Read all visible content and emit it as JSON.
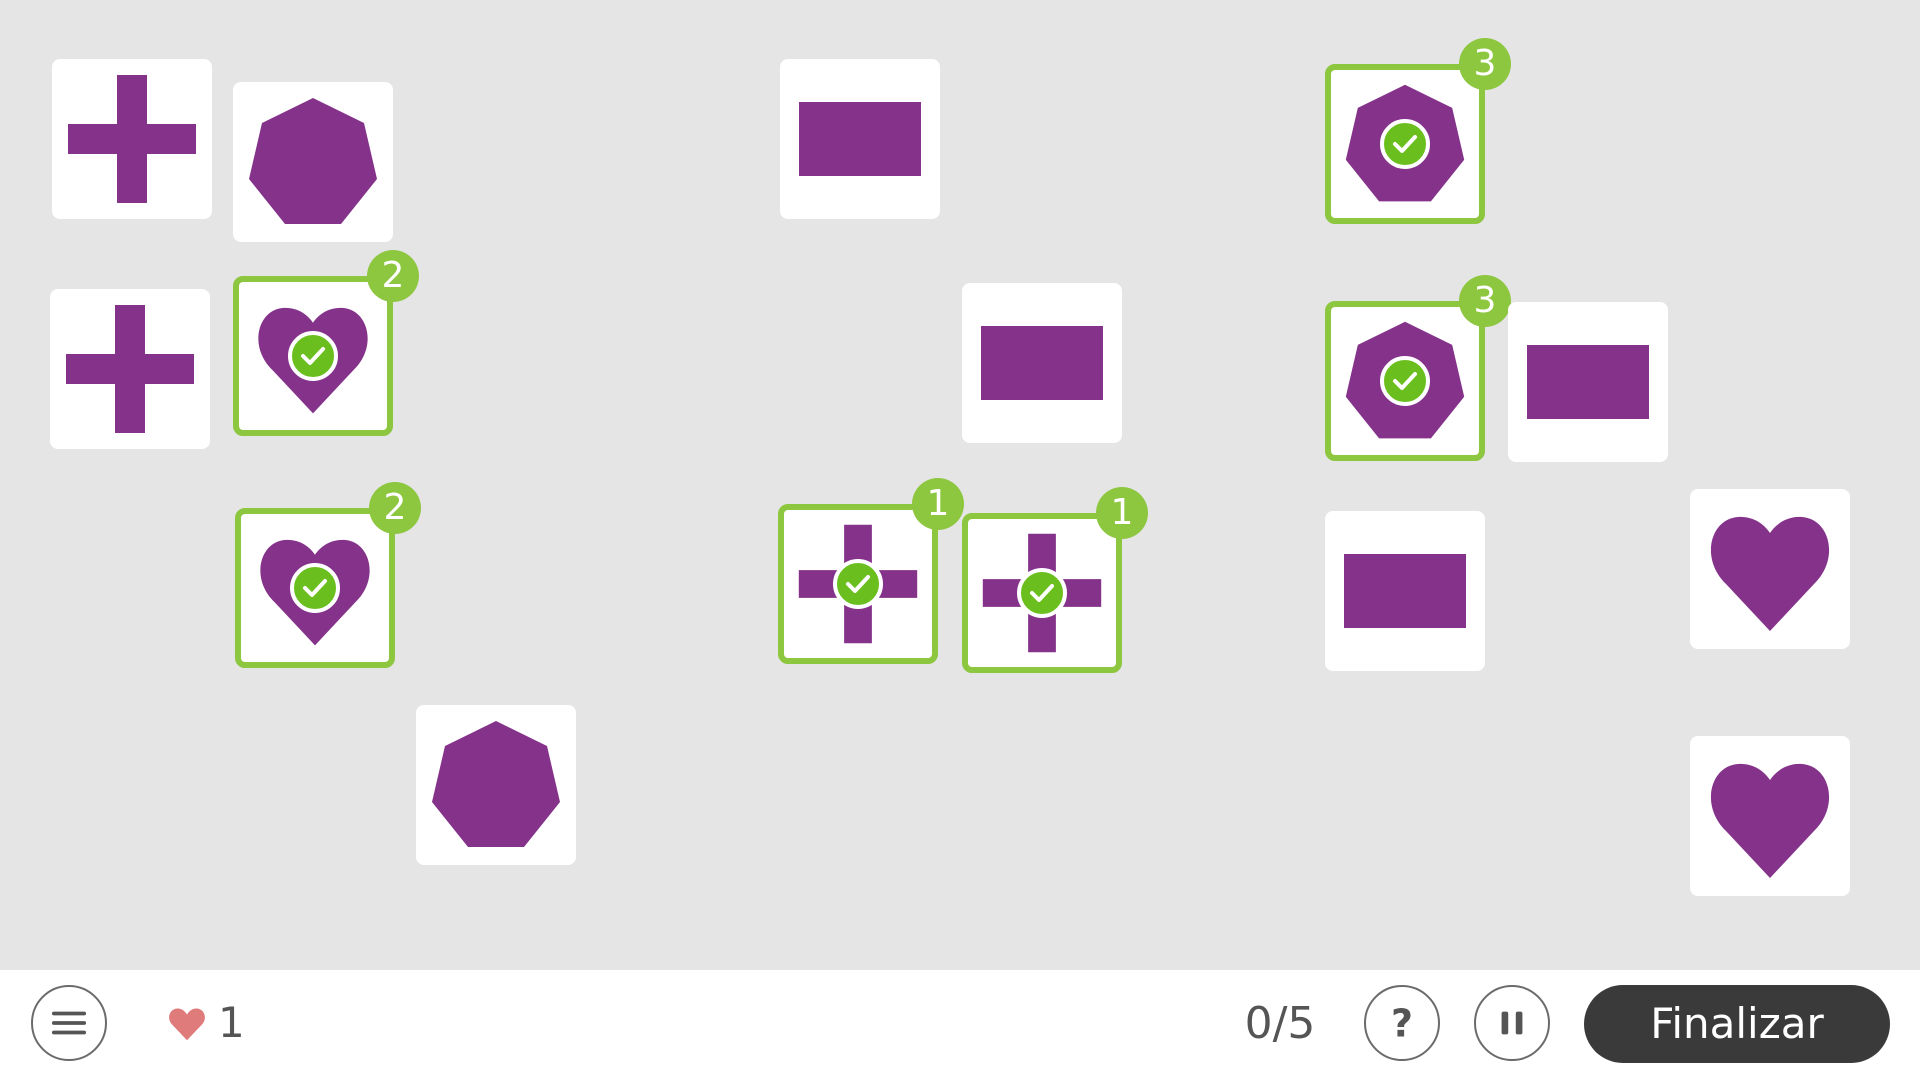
{
  "colors": {
    "shape": "#84328a",
    "matched_border": "#8dc63f",
    "badge": "#8dc63f",
    "check": "#6abf1e",
    "heart": "#e07b7b"
  },
  "cards": [
    {
      "shape": "cross",
      "matched": false,
      "badge": ""
    },
    {
      "shape": "heptagon",
      "matched": false,
      "badge": ""
    },
    {
      "shape": "cross",
      "matched": false,
      "badge": ""
    },
    {
      "shape": "heart",
      "matched": true,
      "badge": "2"
    },
    {
      "shape": "heart",
      "matched": true,
      "badge": "2"
    },
    {
      "shape": "heptagon",
      "matched": false,
      "badge": ""
    },
    {
      "shape": "rectangle",
      "matched": false,
      "badge": ""
    },
    {
      "shape": "rectangle",
      "matched": false,
      "badge": ""
    },
    {
      "shape": "cross",
      "matched": true,
      "badge": "1"
    },
    {
      "shape": "cross",
      "matched": true,
      "badge": "1"
    },
    {
      "shape": "heptagon",
      "matched": true,
      "badge": "3"
    },
    {
      "shape": "heptagon",
      "matched": true,
      "badge": "3"
    },
    {
      "shape": "rectangle",
      "matched": false,
      "badge": ""
    },
    {
      "shape": "rectangle",
      "matched": false,
      "badge": ""
    },
    {
      "shape": "heart",
      "matched": false,
      "badge": ""
    },
    {
      "shape": "heart",
      "matched": false,
      "badge": ""
    }
  ],
  "footer": {
    "menu_icon": "hamburger-icon",
    "lives_icon": "heart-icon",
    "lives": "1",
    "progress": "0/5",
    "help_icon": "question-icon",
    "help_label": "?",
    "pause_icon": "pause-icon",
    "finish_label": "Finalizar"
  }
}
